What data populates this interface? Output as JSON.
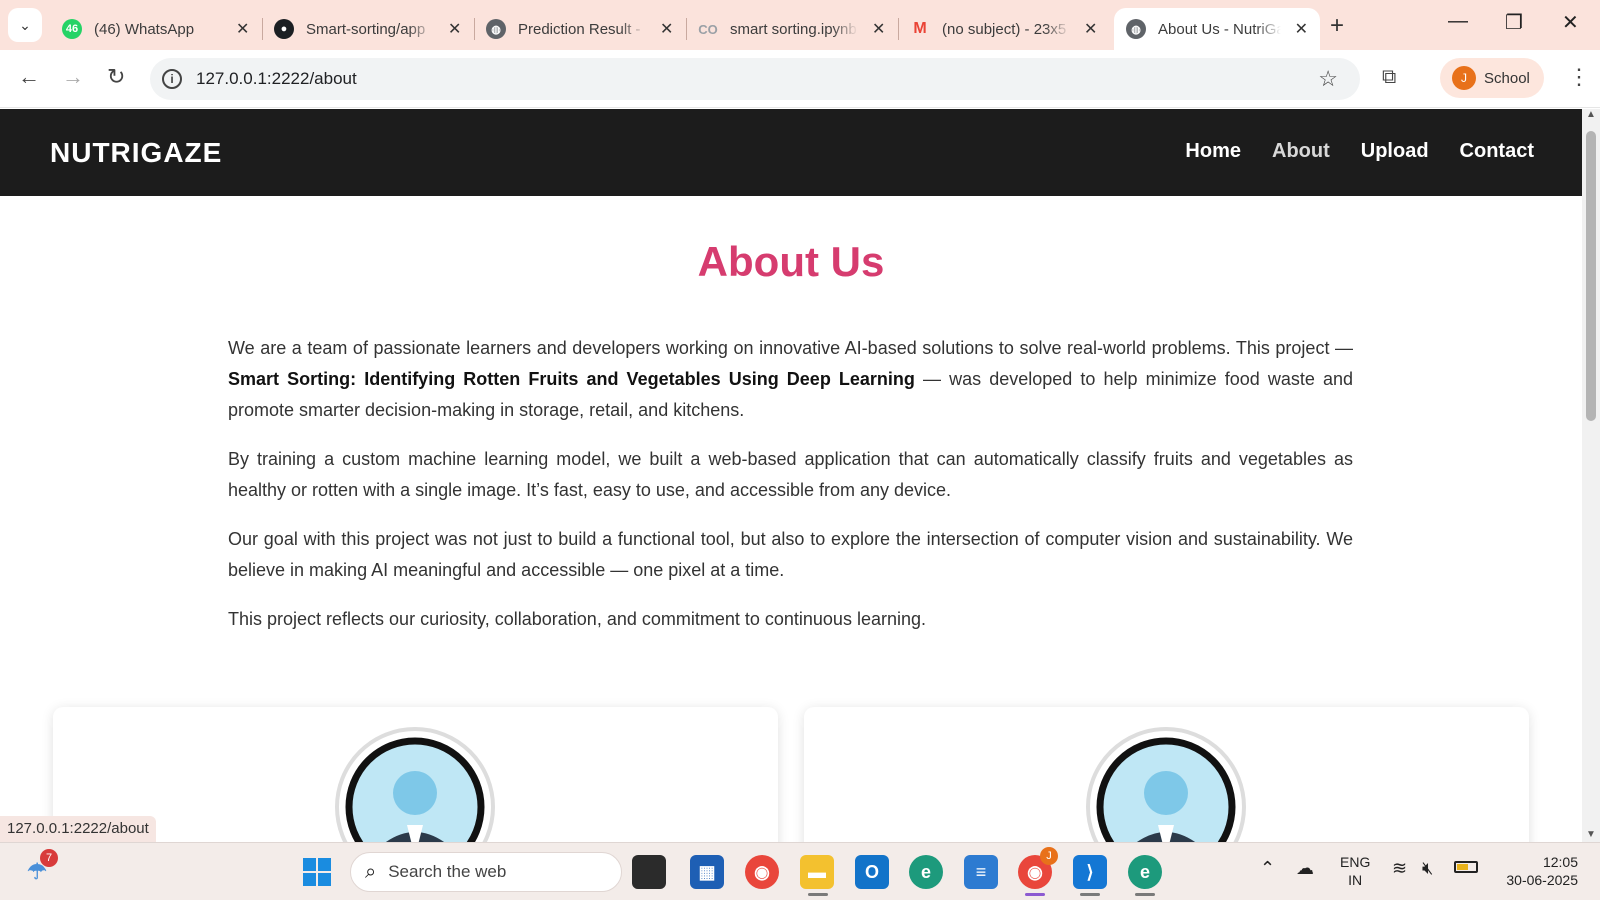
{
  "browser": {
    "tabs": [
      {
        "label": "(46) WhatsApp",
        "icon": "whatsapp-icon",
        "icon_text": "46",
        "color": "#25d366"
      },
      {
        "label": "Smart-sorting/app",
        "icon": "github-icon",
        "icon_text": "",
        "color": "#1b1f23"
      },
      {
        "label": "Prediction Result -",
        "icon": "globe-icon",
        "icon_text": "",
        "color": "#5f6368"
      },
      {
        "label": "smart sorting.ipynb",
        "icon": "colab-icon",
        "icon_text": "CO",
        "color": "#9aa0a6"
      },
      {
        "label": "(no subject) - 23x5",
        "icon": "gmail-icon",
        "icon_text": "M",
        "color": "#ea4335"
      },
      {
        "label": "About Us - NutriGaze",
        "icon": "globe-icon",
        "icon_text": "",
        "color": "#5f6368"
      }
    ],
    "active_tab": 5,
    "url": "127.0.0.1:2222/about",
    "profile": {
      "initial": "J",
      "label": "School"
    },
    "status_url": "127.0.0.1:2222/about"
  },
  "site": {
    "brand": "NUTRIGAZE",
    "nav": [
      "Home",
      "About",
      "Upload",
      "Contact"
    ],
    "current_nav": "About",
    "title": "About Us",
    "p1_a": "We are a team of passionate learners and developers working on innovative AI-based solutions to solve real-world problems. This project — ",
    "p1_b": "Smart Sorting: Identifying Rotten Fruits and Vegetables Using Deep Learning",
    "p1_c": " — was developed to help minimize food waste and promote smarter decision-making in storage, retail, and kitchens.",
    "p2": "By training a custom machine learning model, we built a web-based application that can automatically classify fruits and vegetables as healthy or rotten with a single image. It’s fast, easy to use, and accessible from any device.",
    "p3": "Our goal with this project was not just to build a functional tool, but also to explore the intersection of computer vision and sustainability. We believe in making AI meaningful and accessible — one pixel at a time.",
    "p4": "This project reflects our curiosity, collaboration, and commitment to continuous learning.",
    "accent": "#d63c6f"
  },
  "taskbar": {
    "weather_badge": "7",
    "search_placeholder": "Search the web",
    "chrome_badge": "J",
    "lang1": "ENG",
    "lang2": "IN",
    "time": "12:05",
    "date": "30-06-2025"
  }
}
